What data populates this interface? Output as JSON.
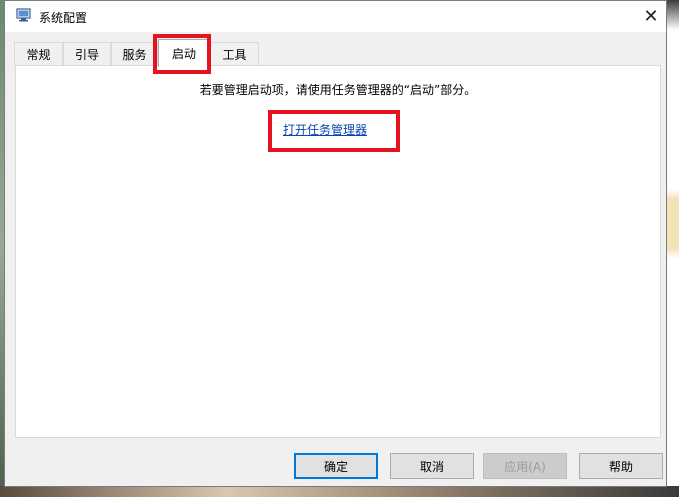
{
  "window": {
    "title": "系统配置",
    "close_glyph": "✕"
  },
  "tabs": [
    {
      "label": "常规",
      "active": false
    },
    {
      "label": "引导",
      "active": false
    },
    {
      "label": "服务",
      "active": false
    },
    {
      "label": "启动",
      "active": true
    },
    {
      "label": "工具",
      "active": false
    }
  ],
  "startup_panel": {
    "message": "若要管理启动项，请使用任务管理器的“启动”部分。",
    "link_label": "打开任务管理器"
  },
  "buttons": {
    "ok": "确定",
    "cancel": "取消",
    "apply": "应用(A)",
    "help": "帮助"
  },
  "colors": {
    "highlight": "#e3141f",
    "link": "#0645ad",
    "default_button_border": "#0078d7"
  },
  "icons": {
    "app": "system-config-icon",
    "close": "close-icon"
  }
}
